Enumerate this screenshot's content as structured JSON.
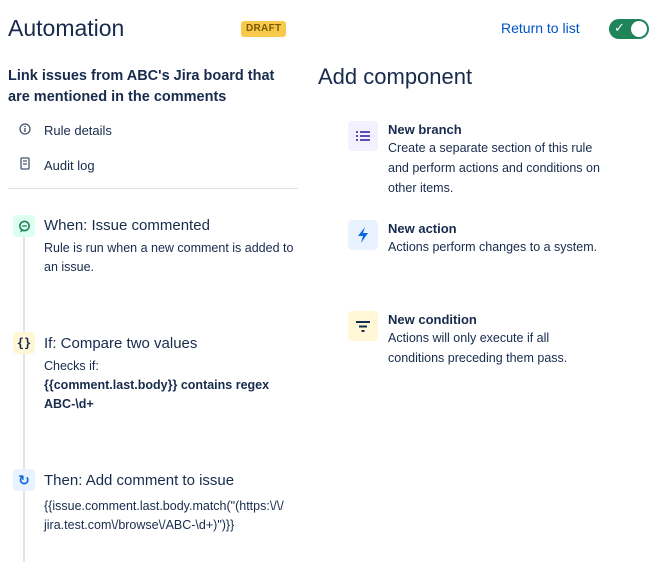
{
  "header": {
    "title": "Automation",
    "status_badge": "DRAFT",
    "return_link": "Return to list",
    "toggle": {
      "enabled": true,
      "check_glyph": "✓"
    }
  },
  "rule": {
    "name": "Link issues from ABC's Jira board that are mentioned in the comments",
    "nav": [
      {
        "label": "Rule details",
        "icon": "info-icon"
      },
      {
        "label": "Audit log",
        "icon": "document-icon"
      }
    ]
  },
  "steps": [
    {
      "title": "When: Issue commented",
      "icon": "comment-trigger-icon",
      "icon_glyph": "◎",
      "description": "Rule is run when a new comment is added to an issue."
    },
    {
      "title": "If: Compare two values",
      "icon": "braces-icon",
      "icon_glyph": "{}",
      "description_prefix": "Checks if:",
      "description_bold": "{{comment.last.body}} contains regex ABC-\\d+"
    },
    {
      "title": "Then: Add comment to issue",
      "icon": "refresh-action-icon",
      "icon_glyph": "↻",
      "description": "{{issue.comment.last.body.match(\"(https:\\/\\/jira.test.com\\/browse\\/ABC-\\d+)\")}}"
    }
  ],
  "add_component": {
    "heading": "Add component",
    "items": [
      {
        "title": "New branch",
        "icon": "branch-list-icon",
        "description": "Create a separate section of this rule and perform actions and conditions on other items."
      },
      {
        "title": "New action",
        "icon": "lightning-icon",
        "description": "Actions perform changes to a system."
      },
      {
        "title": "New condition",
        "icon": "filter-icon",
        "description": "Actions will only execute if all conditions preceding them pass."
      }
    ]
  },
  "colors": {
    "accent": "#0052cc",
    "toggle_on": "#1f845a",
    "draft_badge": "#f8c94a",
    "trigger_icon_bg": "#dcfff1",
    "condition_icon_bg": "#fff7d6",
    "action_icon_bg": "#e9f2ff",
    "branch_icon_bg": "#f3f0ff"
  }
}
